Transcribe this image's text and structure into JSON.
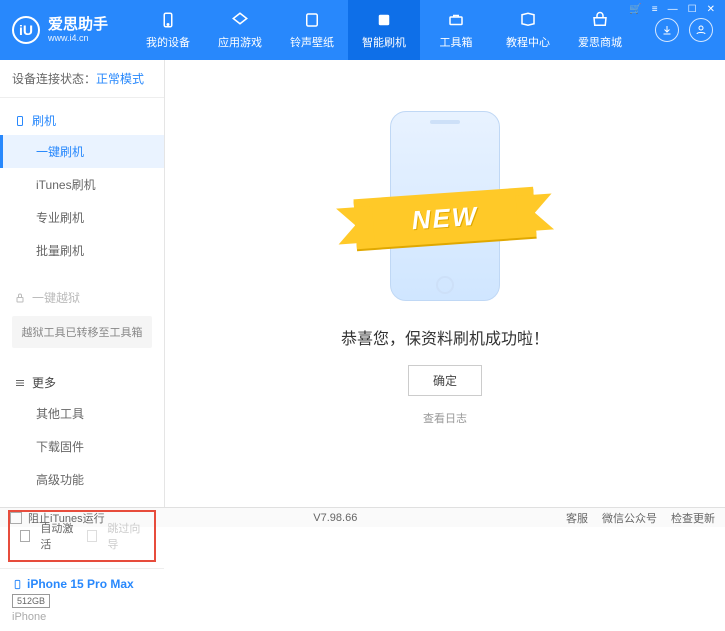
{
  "brand": {
    "name": "爱思助手",
    "url": "www.i4.cn",
    "logo_letter": "iU"
  },
  "window": {
    "cart": "🛒",
    "menu": "≡",
    "min": "—",
    "max": "☐",
    "close": "✕"
  },
  "nav": [
    {
      "label": "我的设备"
    },
    {
      "label": "应用游戏"
    },
    {
      "label": "铃声壁纸"
    },
    {
      "label": "智能刷机",
      "active": true
    },
    {
      "label": "工具箱"
    },
    {
      "label": "教程中心"
    },
    {
      "label": "爱思商城"
    }
  ],
  "header_icons": {
    "download": "↓",
    "user": "👤"
  },
  "sidebar": {
    "status_label": "设备连接状态：",
    "status_value": "正常模式",
    "group1": {
      "title": "刷机",
      "items": [
        "一键刷机",
        "iTunes刷机",
        "专业刷机",
        "批量刷机"
      ]
    },
    "group2": {
      "title": "一键越狱",
      "note": "越狱工具已转移至工具箱"
    },
    "group3": {
      "title": "更多",
      "items": [
        "其他工具",
        "下载固件",
        "高级功能"
      ]
    },
    "checkbox1": "自动激活",
    "checkbox2": "跳过向导",
    "device": {
      "name": "iPhone 15 Pro Max",
      "storage": "512GB",
      "type": "iPhone"
    }
  },
  "main": {
    "ribbon": "NEW",
    "message": "恭喜您，保资料刷机成功啦！",
    "ok": "确定",
    "log": "查看日志"
  },
  "footer": {
    "block_itunes": "阻止iTunes运行",
    "version": "V7.98.66",
    "links": [
      "客服",
      "微信公众号",
      "检查更新"
    ]
  }
}
